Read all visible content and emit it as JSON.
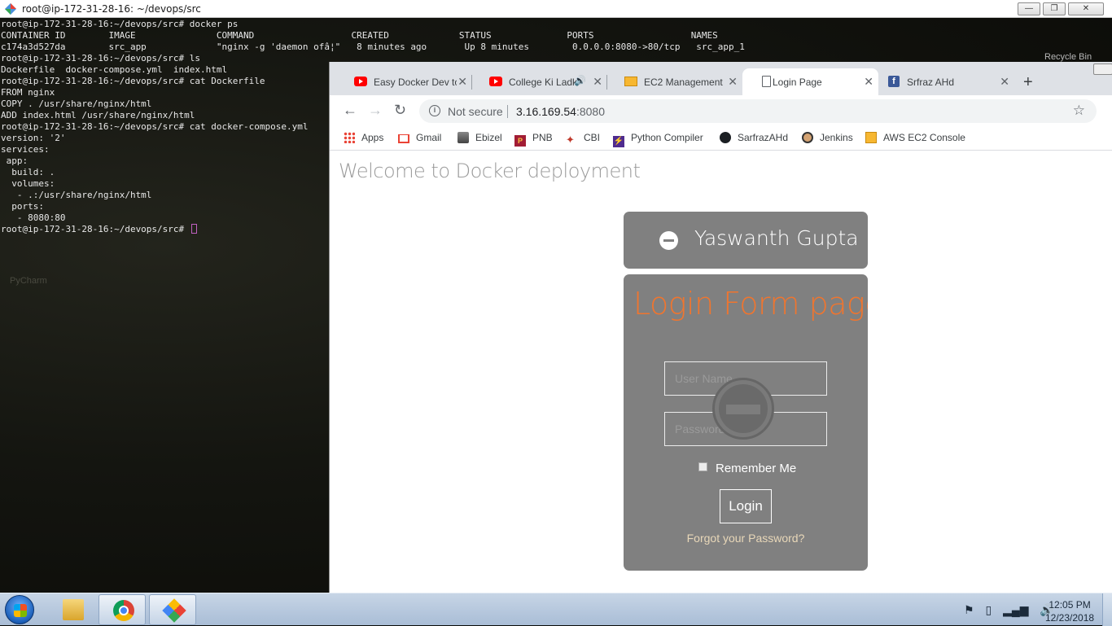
{
  "terminal": {
    "title": "root@ip-172-31-28-16: ~/devops/src",
    "lines": [
      "root@ip-172-31-28-16:~/devops/src# docker ps",
      "CONTAINER ID        IMAGE               COMMAND                  CREATED             STATUS              PORTS                  NAMES",
      "c174a3d527da        src_app             \"nginx -g 'daemon ofâ¦\"   8 minutes ago       Up 8 minutes        0.0.0.0:8080->80/tcp   src_app_1",
      "root@ip-172-31-28-16:~/devops/src# ls",
      "Dockerfile  docker-compose.yml  index.html",
      "root@ip-172-31-28-16:~/devops/src# cat Dockerfile",
      "FROM nginx",
      "COPY . /usr/share/nginx/html",
      "ADD index.html /usr/share/nginx/html",
      "root@ip-172-31-28-16:~/devops/src# cat docker-compose.yml",
      "version: '2'",
      "services:",
      " app:",
      "  build: .",
      "  volumes:",
      "   - .:/usr/share/nginx/html",
      "  ports:",
      "   - 8080:80"
    ],
    "prompt": "root@ip-172-31-28-16:~/devops/src# ",
    "desktop_recycle_bin": "Recycle Bin",
    "desktop_label": "PyCharm"
  },
  "browser": {
    "tabs": [
      {
        "label": "Easy Docker Dev to",
        "icon": "youtube-icon"
      },
      {
        "label": "College Ki Ladk",
        "icon": "youtube-icon",
        "audio": "🔊"
      },
      {
        "label": "EC2 Management",
        "icon": "aws-icon"
      },
      {
        "label": "Login Page",
        "icon": "page-icon",
        "active": true
      },
      {
        "label": "Srfraz AHd",
        "icon": "facebook-icon"
      }
    ],
    "security_label": "Not secure",
    "url_host": "3.16.169.54",
    "url_port": ":8080",
    "bookmarks": [
      "Apps",
      "Gmail",
      "Ebizel",
      "PNB",
      "CBI",
      "Python Compiler",
      "SarfrazAHd",
      "Jenkins",
      "AWS EC2 Console"
    ]
  },
  "page": {
    "heading": "Welcome to Docker deployment",
    "user_name": "Yaswanth Gupta",
    "form_title": "Login Form page",
    "username_placeholder": "User Name",
    "password_placeholder": "Password",
    "remember_label": "Remember Me",
    "login_button": "Login",
    "forgot_link": "Forgot your Password?"
  },
  "taskbar": {
    "time": "12:05 PM",
    "date": "12/23/2018"
  },
  "colors": {
    "accent_orange": "#f0752e",
    "card_gray": "#808080",
    "terminal_bg": "#0b0b08"
  }
}
